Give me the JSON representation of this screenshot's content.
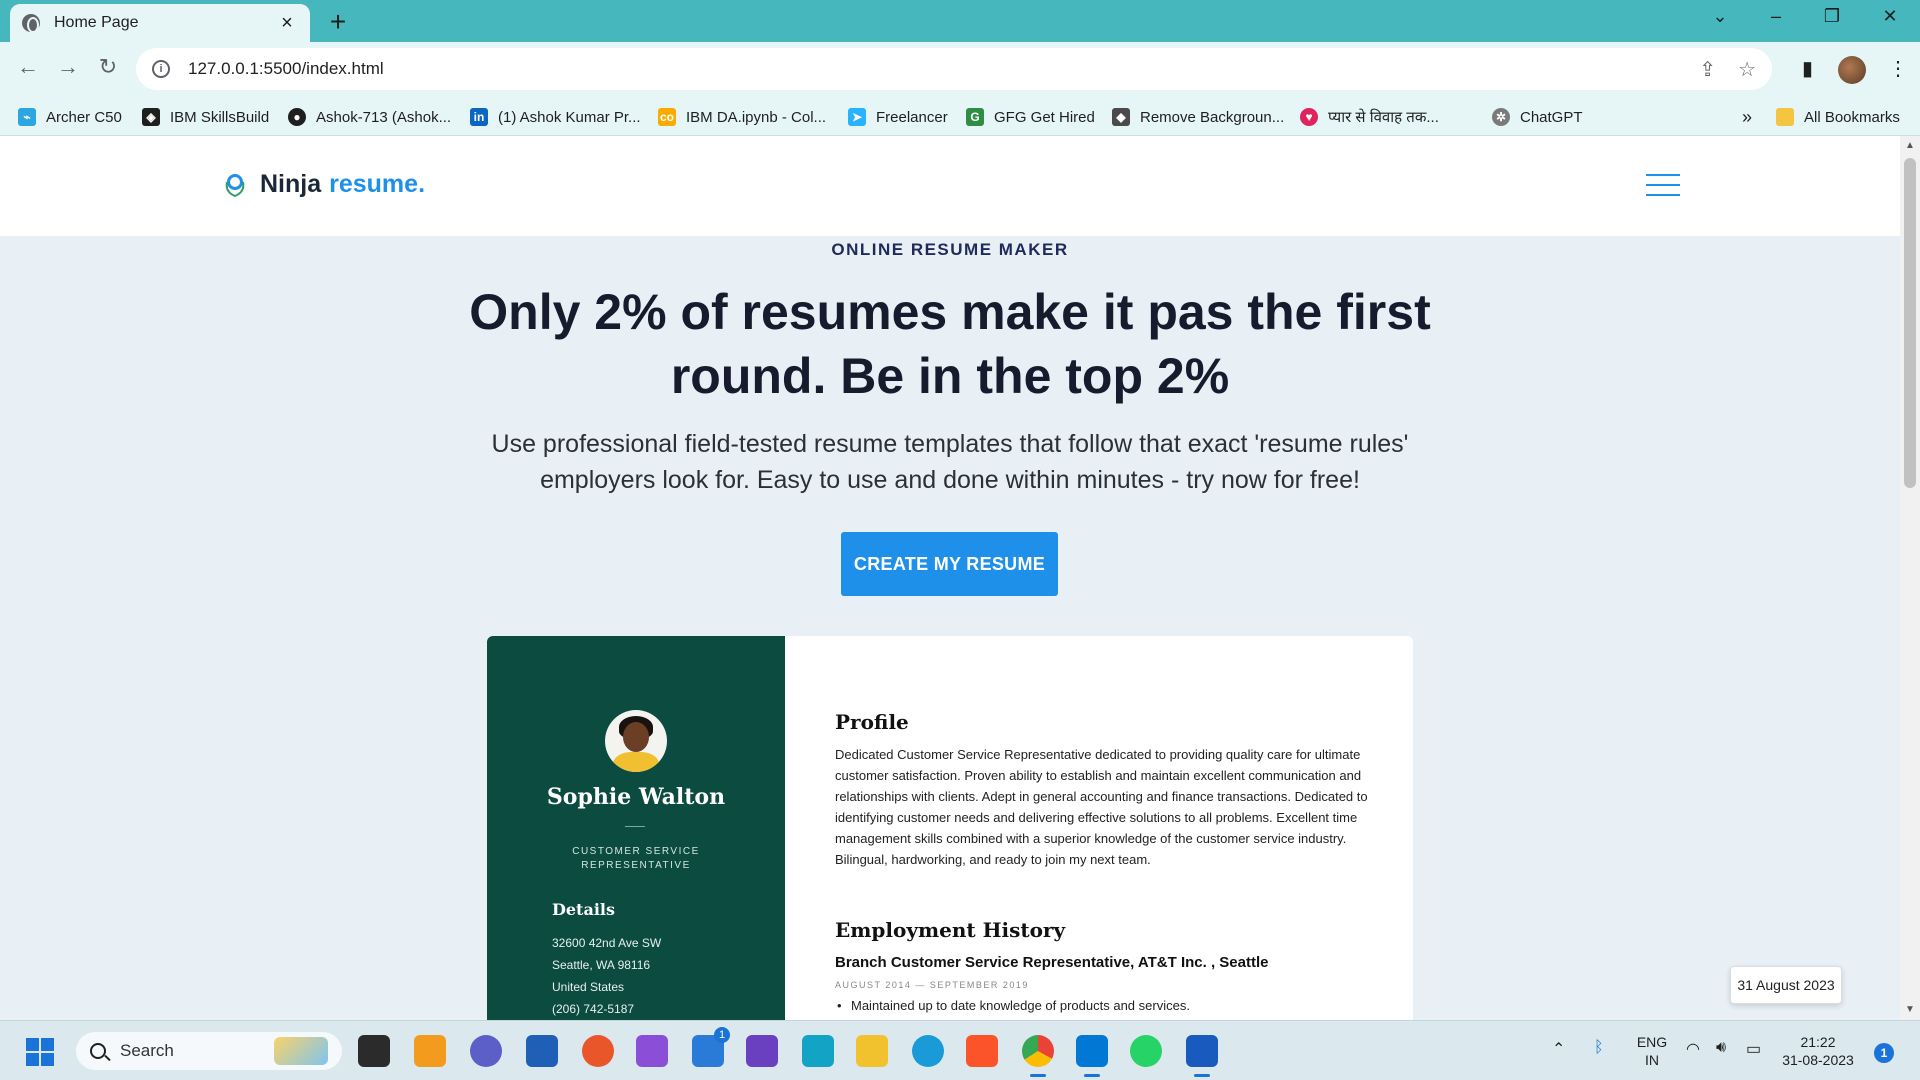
{
  "browser": {
    "tab_title": "Home Page",
    "url": "127.0.0.1:5500/index.html",
    "bookmarks": [
      {
        "label": "Archer C50",
        "icon": "tp-link-icon",
        "color": "#2ca6e0"
      },
      {
        "label": "IBM SkillsBuild",
        "icon": "ibm-icon",
        "color": "#1f1f1f"
      },
      {
        "label": "Ashok-713 (Ashok...",
        "icon": "github-icon",
        "color": "#1f1f1f"
      },
      {
        "label": "(1) Ashok Kumar Pr...",
        "icon": "linkedin-icon",
        "color": "#0a66c2"
      },
      {
        "label": "IBM DA.ipynb - Col...",
        "icon": "colab-icon",
        "color": "#f9ab00"
      },
      {
        "label": "Freelancer",
        "icon": "freelancer-icon",
        "color": "#29b2fe"
      },
      {
        "label": "GFG Get Hired",
        "icon": "gfg-icon",
        "color": "#2f8d46"
      },
      {
        "label": "Remove Backgroun...",
        "icon": "removebg-icon",
        "color": "#4a4a4a"
      },
      {
        "label": "प्यार से विवाह तक...",
        "icon": "heart-icon",
        "color": "#e0245e"
      },
      {
        "label": "ChatGPT",
        "icon": "chatgpt-icon",
        "color": "#7a7a7a"
      }
    ],
    "all_bookmarks": "All Bookmarks",
    "overflow": "»"
  },
  "site": {
    "brand": "Ninja",
    "brand_accent": "resume.",
    "accent_color": "#1e90ea",
    "eyebrow": "ONLINE RESUME MAKER",
    "headline": "Only 2% of resumes make it pas the first round. Be in the top 2%",
    "subtext": "Use professional field-tested resume templates that follow that exact 'resume rules' employers look for. Easy to use and done within minutes - try now for free!",
    "cta": "CREATE MY RESUME"
  },
  "resume": {
    "name": "Sophie Walton",
    "role": "CUSTOMER SERVICE REPRESENTATIVE",
    "details_heading": "Details",
    "details": [
      "32600 42nd Ave SW",
      "Seattle, WA 98116",
      "United States",
      "(206) 742-5187"
    ],
    "profile_heading": "Profile",
    "profile_text": "Dedicated Customer Service Representative dedicated to providing quality care for ultimate customer satisfaction. Proven ability to establish and maintain excellent communication and relationships with clients. Adept in general accounting and finance transactions. Dedicated to identifying customer needs and delivering effective solutions to all problems. Excellent time management skills combined with a superior knowledge of the customer service industry. Bilingual, hardworking, and ready to join my next team.",
    "employment_heading": "Employment History",
    "job_title": "Branch Customer Service Representative, AT&T Inc. , Seattle",
    "job_dates": "AUGUST 2014 — SEPTEMBER 2019",
    "job_bullet": "Maintained up to date knowledge of products and services."
  },
  "date_popup": "31 August 2023",
  "taskbar": {
    "search_label": "Search",
    "language": "ENG",
    "region": "IN",
    "time": "21:22",
    "date": "31-08-2023",
    "notification_count": "1",
    "mail_badge": "1"
  }
}
